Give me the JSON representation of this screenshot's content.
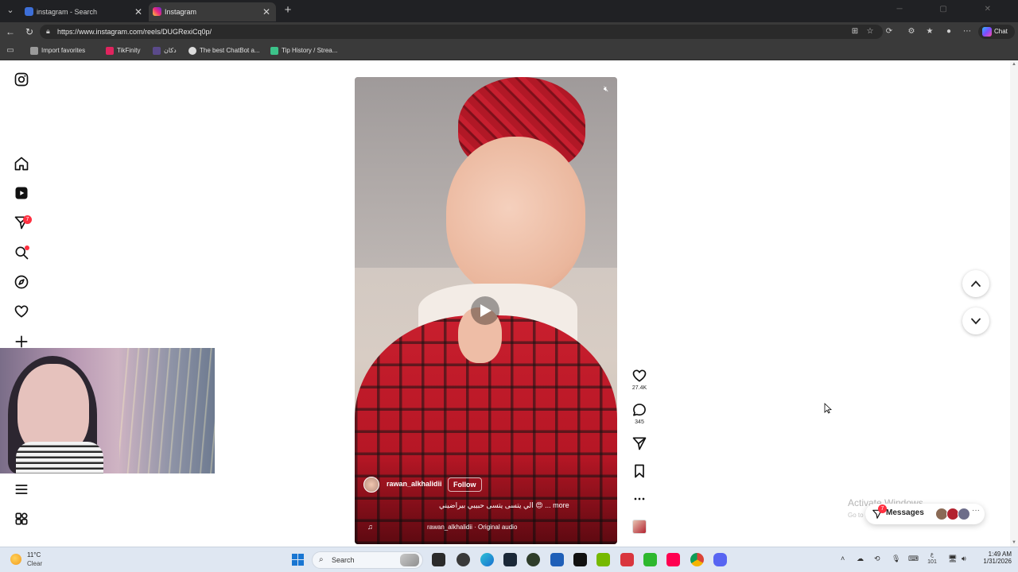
{
  "browser": {
    "tabs": [
      {
        "label": "instagram - Search",
        "active": false
      },
      {
        "label": "Instagram",
        "active": true
      }
    ],
    "url": "https://www.instagram.com/reels/DUGRexiCq0p/",
    "chat_label": "Chat",
    "bookmarks": [
      {
        "label": "Import favorites",
        "color": "#7a7a7a"
      },
      {
        "label": "TikFinity",
        "color": "#e0245e"
      },
      {
        "label": "دكان",
        "color": "#5a4a8a"
      },
      {
        "label": "The best ChatBot a...",
        "color": "#dddddd"
      },
      {
        "label": "Tip History / Strea...",
        "color": "#3cc38a"
      }
    ]
  },
  "sidebar": {
    "notifications_badge": "7",
    "icons": [
      "instagram-icon",
      "home-icon",
      "reels-icon",
      "direct-icon",
      "search-icon",
      "explore-icon",
      "heart-icon",
      "create-icon",
      "menu-icon",
      "apps-icon"
    ]
  },
  "reel": {
    "author": "rawan_alkhalidii",
    "follow_label": "Follow",
    "caption": "الي يتسى يتسى حبيبي بيراضيني 😍 ... more",
    "audio": "rawan_alkhalidii · Original audio",
    "likes": "27.4K",
    "comments": "345"
  },
  "overlay": {
    "activate_title": "Activate Windows",
    "activate_sub": "Go to Settings to activate Windows."
  },
  "messages": {
    "label": "Messages",
    "badge": "7",
    "more": "···"
  },
  "taskbar": {
    "temp": "11°C",
    "condition": "Clear",
    "search_placeholder": "Search",
    "time": "1:49 AM",
    "date": "1/31/2026",
    "lang": "ع\n101"
  }
}
